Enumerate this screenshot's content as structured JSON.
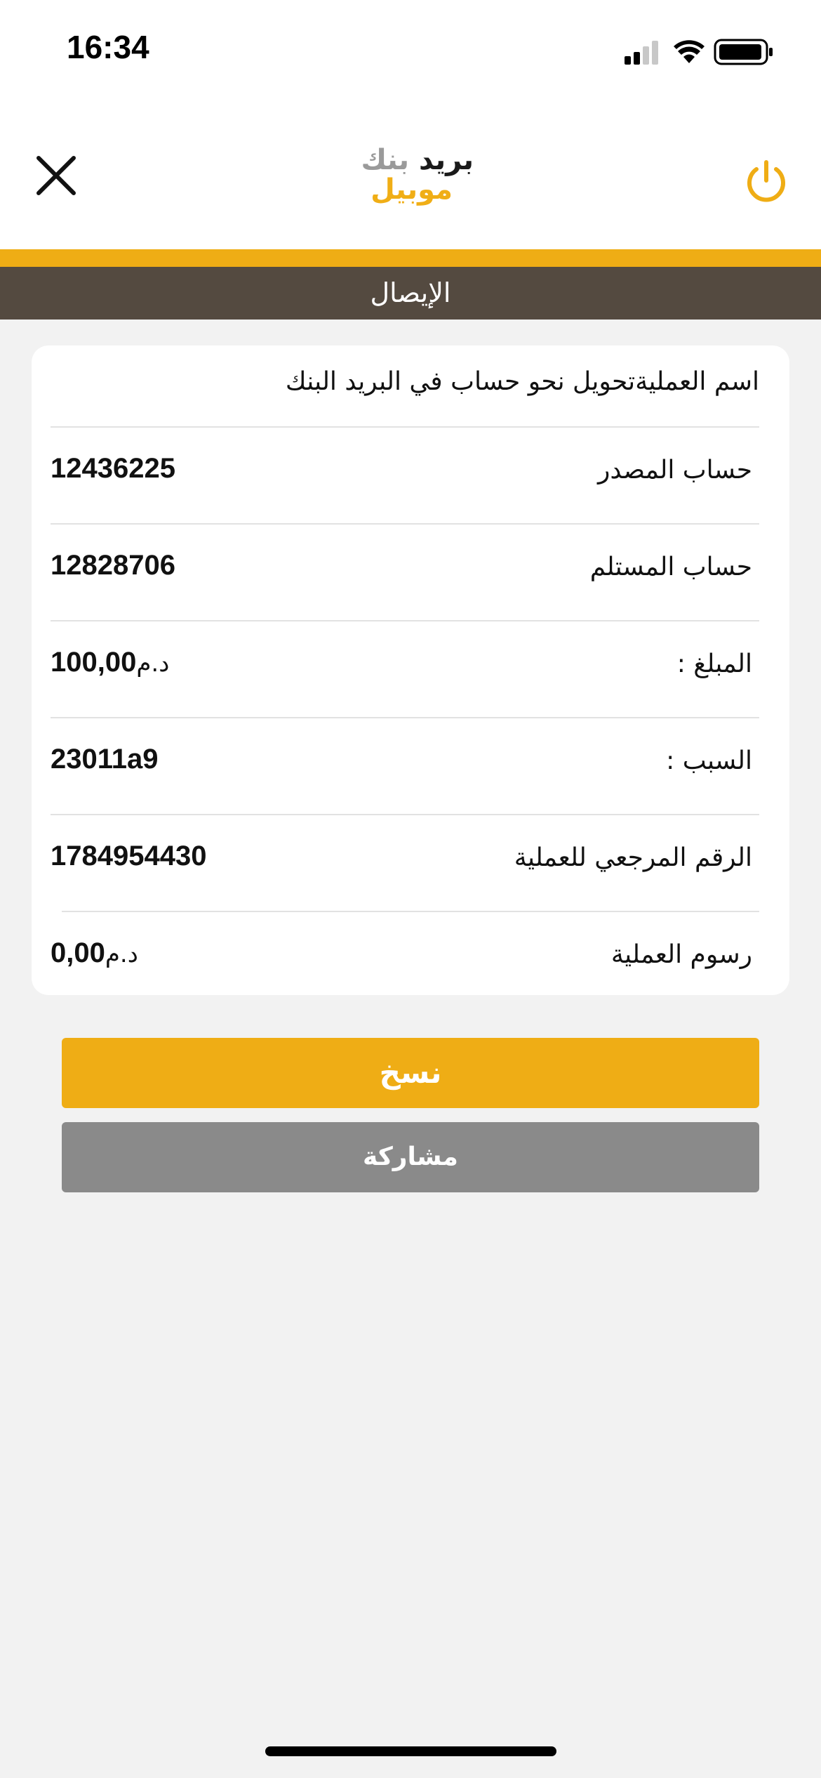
{
  "status_bar": {
    "time": "16:34"
  },
  "header": {
    "logo": {
      "word1": "بريد",
      "word2": "بنك",
      "word3": "موبيل"
    },
    "close_icon": "close-icon",
    "power_icon": "power-icon"
  },
  "colors": {
    "accent": "#efad15",
    "title_bar": "#544a40",
    "share_button": "#8a8a8a"
  },
  "page_title": "الإيصال",
  "receipt": {
    "operation_line": "اسم العمليةتحويل نحو حساب في البريد البنك",
    "rows": [
      {
        "label": "حساب المصدر",
        "value": "12436225",
        "currency": ""
      },
      {
        "label": "حساب المستلم",
        "value": "12828706",
        "currency": ""
      },
      {
        "label": "المبلغ :",
        "value": "100,00",
        "currency": "د.م"
      },
      {
        "label": "السبب :",
        "value": "23011a9",
        "currency": ""
      },
      {
        "label": "الرقم المرجعي للعملية",
        "value": "1784954430",
        "currency": ""
      },
      {
        "label": "رسوم العملية",
        "value": "0,00",
        "currency": "د.م"
      }
    ]
  },
  "actions": {
    "copy_label": "نسخ",
    "share_label": "مشاركة"
  }
}
